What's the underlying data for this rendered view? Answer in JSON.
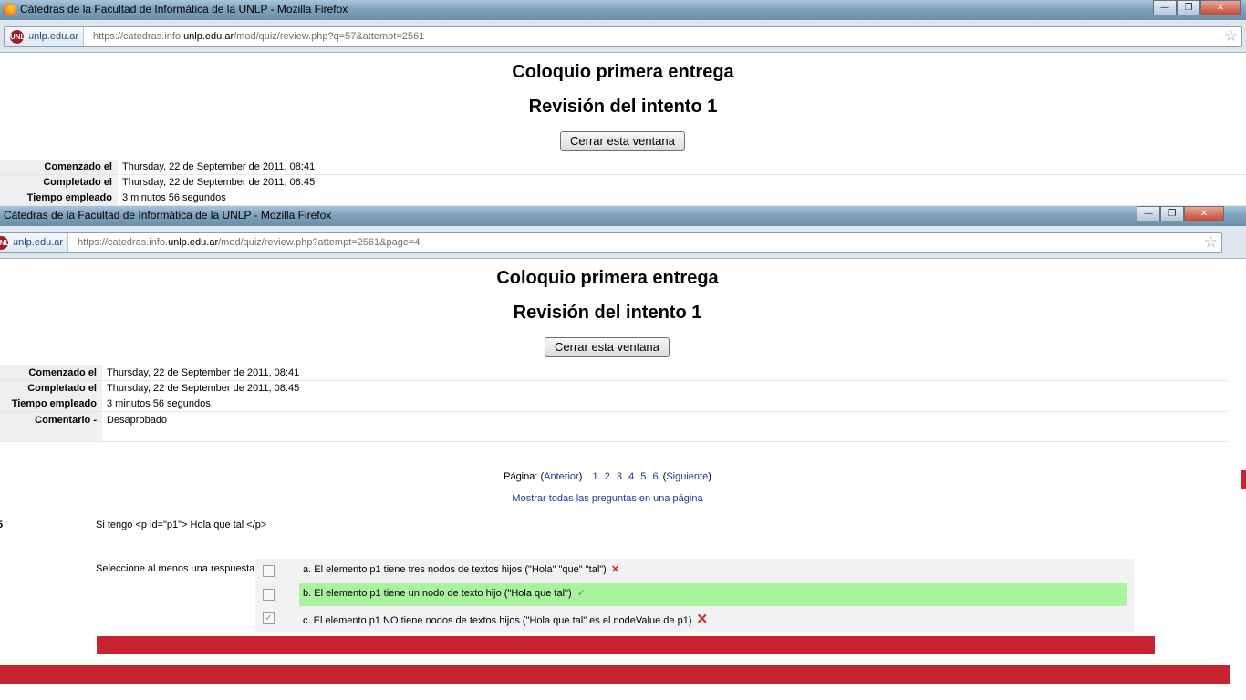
{
  "window1": {
    "title": "Cátedras de la Facultad de Informática de la UNLP - Mozilla Firefox",
    "site_identity": "unlp.edu.ar",
    "url_prefix": "https://catedras.info.",
    "url_domain": "unlp.edu.ar",
    "url_suffix": "/mod/quiz/review.php?q=57&attempt=2561",
    "page_title": "Coloquio primera entrega",
    "review_title": "Revisión del intento 1",
    "close_label": "Cerrar esta ventana",
    "info": [
      {
        "label": "Comenzado el",
        "value": "Thursday, 22 de September de 2011, 08:41"
      },
      {
        "label": "Completado el",
        "value": "Thursday, 22 de September de 2011, 08:45"
      },
      {
        "label": "Tiempo empleado",
        "value": "3 minutos 56 segundos"
      }
    ]
  },
  "window2": {
    "title": "Cátedras de la Facultad de Informática de la UNLP - Mozilla Firefox",
    "site_identity": "unlp.edu.ar",
    "url_prefix": "https://catedras.info.",
    "url_domain": "unlp.edu.ar",
    "url_suffix": "/mod/quiz/review.php?attempt=2561&page=4",
    "page_title": "Coloquio primera entrega",
    "review_title": "Revisión del intento 1",
    "close_label": "Cerrar esta ventana",
    "info": [
      {
        "label": "Comenzado el",
        "value": "Thursday, 22 de September de 2011, 08:41"
      },
      {
        "label": "Completado el",
        "value": "Thursday, 22 de September de 2011, 08:45"
      },
      {
        "label": "Tiempo empleado",
        "value": "3 minutos 56 segundos"
      },
      {
        "label": "Comentario -",
        "value": "Desaprobado"
      }
    ],
    "pager": {
      "label": "Página:",
      "prev": "Anterior",
      "pages": [
        "1",
        "2",
        "3",
        "4",
        "5",
        "6"
      ],
      "next": "Siguiente"
    },
    "show_all": "Mostrar todas las preguntas en una página",
    "question": {
      "number": "5",
      "text": "Si tengo <p id=\"p1\"> Hola que tal </p>",
      "prompt": "Seleccione al menos una respuesta.",
      "answers": [
        {
          "label": "a. El elemento p1 tiene tres nodos de textos hijos (\"Hola\" \"que\" \"tal\")",
          "checked": false,
          "mark": "x"
        },
        {
          "label": "b. El elemento p1 tiene un nodo de texto hijo (\"Hola que tal\")",
          "checked": false,
          "mark": "check"
        },
        {
          "label": "c. El elemento p1 NO tiene nodos de textos hijos (\"Hola que tal\" es el nodeValue de p1)",
          "checked": true,
          "mark": "x"
        }
      ]
    }
  },
  "window_buttons": {
    "minimize": "—",
    "maximize": "❐",
    "close": "✕"
  },
  "icons": {
    "site": "UNLP",
    "star": "☆",
    "check": "✓",
    "x": "✕"
  },
  "colors": {
    "correct_bg": "#a8f2a0",
    "error_red": "#c6252f",
    "link": "#1a3a9a"
  }
}
